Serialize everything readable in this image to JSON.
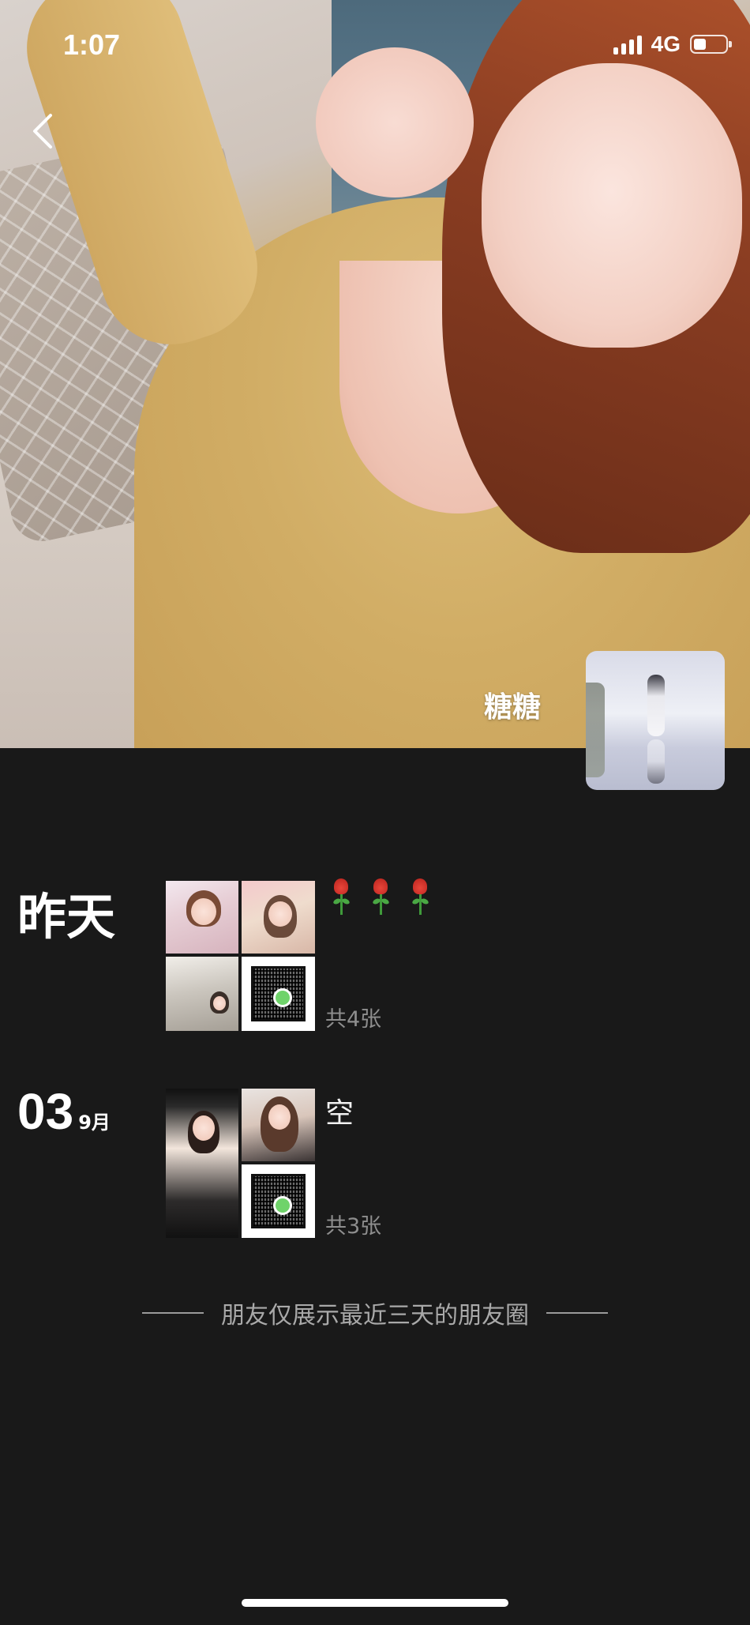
{
  "status_bar": {
    "time": "1:07",
    "network": "4G",
    "signal_bars": 4,
    "battery_level": 0.4
  },
  "profile": {
    "nickname": "糖糖",
    "avatar_icon": "avatar-image"
  },
  "posts": [
    {
      "date_label": "昨天",
      "text": "🌹 🌹 🌹",
      "photo_count": "共4张"
    },
    {
      "day": "03",
      "month": "9月",
      "text": "空",
      "photo_count": "共3张"
    }
  ],
  "footer": {
    "note": "朋友仅展示最近三天的朋友圈"
  },
  "icons": {
    "back": "chevron-left-icon",
    "signal": "signal-icon",
    "battery": "battery-icon",
    "rose": "rose-icon"
  },
  "colors": {
    "background": "#191919",
    "secondary_text": "#8e8e8e",
    "footer_text": "#a9a9a9"
  }
}
